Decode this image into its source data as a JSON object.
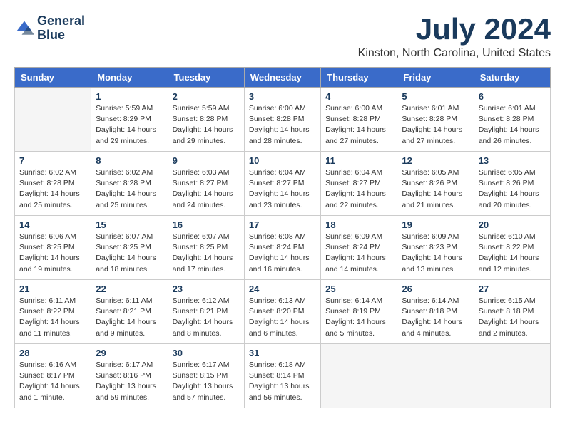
{
  "logo": {
    "line1": "General",
    "line2": "Blue"
  },
  "title": "July 2024",
  "location": "Kinston, North Carolina, United States",
  "days_of_week": [
    "Sunday",
    "Monday",
    "Tuesday",
    "Wednesday",
    "Thursday",
    "Friday",
    "Saturday"
  ],
  "weeks": [
    [
      {
        "day": "",
        "info": ""
      },
      {
        "day": "1",
        "info": "Sunrise: 5:59 AM\nSunset: 8:29 PM\nDaylight: 14 hours\nand 29 minutes."
      },
      {
        "day": "2",
        "info": "Sunrise: 5:59 AM\nSunset: 8:28 PM\nDaylight: 14 hours\nand 29 minutes."
      },
      {
        "day": "3",
        "info": "Sunrise: 6:00 AM\nSunset: 8:28 PM\nDaylight: 14 hours\nand 28 minutes."
      },
      {
        "day": "4",
        "info": "Sunrise: 6:00 AM\nSunset: 8:28 PM\nDaylight: 14 hours\nand 27 minutes."
      },
      {
        "day": "5",
        "info": "Sunrise: 6:01 AM\nSunset: 8:28 PM\nDaylight: 14 hours\nand 27 minutes."
      },
      {
        "day": "6",
        "info": "Sunrise: 6:01 AM\nSunset: 8:28 PM\nDaylight: 14 hours\nand 26 minutes."
      }
    ],
    [
      {
        "day": "7",
        "info": "Sunrise: 6:02 AM\nSunset: 8:28 PM\nDaylight: 14 hours\nand 25 minutes."
      },
      {
        "day": "8",
        "info": "Sunrise: 6:02 AM\nSunset: 8:28 PM\nDaylight: 14 hours\nand 25 minutes."
      },
      {
        "day": "9",
        "info": "Sunrise: 6:03 AM\nSunset: 8:27 PM\nDaylight: 14 hours\nand 24 minutes."
      },
      {
        "day": "10",
        "info": "Sunrise: 6:04 AM\nSunset: 8:27 PM\nDaylight: 14 hours\nand 23 minutes."
      },
      {
        "day": "11",
        "info": "Sunrise: 6:04 AM\nSunset: 8:27 PM\nDaylight: 14 hours\nand 22 minutes."
      },
      {
        "day": "12",
        "info": "Sunrise: 6:05 AM\nSunset: 8:26 PM\nDaylight: 14 hours\nand 21 minutes."
      },
      {
        "day": "13",
        "info": "Sunrise: 6:05 AM\nSunset: 8:26 PM\nDaylight: 14 hours\nand 20 minutes."
      }
    ],
    [
      {
        "day": "14",
        "info": "Sunrise: 6:06 AM\nSunset: 8:25 PM\nDaylight: 14 hours\nand 19 minutes."
      },
      {
        "day": "15",
        "info": "Sunrise: 6:07 AM\nSunset: 8:25 PM\nDaylight: 14 hours\nand 18 minutes."
      },
      {
        "day": "16",
        "info": "Sunrise: 6:07 AM\nSunset: 8:25 PM\nDaylight: 14 hours\nand 17 minutes."
      },
      {
        "day": "17",
        "info": "Sunrise: 6:08 AM\nSunset: 8:24 PM\nDaylight: 14 hours\nand 16 minutes."
      },
      {
        "day": "18",
        "info": "Sunrise: 6:09 AM\nSunset: 8:24 PM\nDaylight: 14 hours\nand 14 minutes."
      },
      {
        "day": "19",
        "info": "Sunrise: 6:09 AM\nSunset: 8:23 PM\nDaylight: 14 hours\nand 13 minutes."
      },
      {
        "day": "20",
        "info": "Sunrise: 6:10 AM\nSunset: 8:22 PM\nDaylight: 14 hours\nand 12 minutes."
      }
    ],
    [
      {
        "day": "21",
        "info": "Sunrise: 6:11 AM\nSunset: 8:22 PM\nDaylight: 14 hours\nand 11 minutes."
      },
      {
        "day": "22",
        "info": "Sunrise: 6:11 AM\nSunset: 8:21 PM\nDaylight: 14 hours\nand 9 minutes."
      },
      {
        "day": "23",
        "info": "Sunrise: 6:12 AM\nSunset: 8:21 PM\nDaylight: 14 hours\nand 8 minutes."
      },
      {
        "day": "24",
        "info": "Sunrise: 6:13 AM\nSunset: 8:20 PM\nDaylight: 14 hours\nand 6 minutes."
      },
      {
        "day": "25",
        "info": "Sunrise: 6:14 AM\nSunset: 8:19 PM\nDaylight: 14 hours\nand 5 minutes."
      },
      {
        "day": "26",
        "info": "Sunrise: 6:14 AM\nSunset: 8:18 PM\nDaylight: 14 hours\nand 4 minutes."
      },
      {
        "day": "27",
        "info": "Sunrise: 6:15 AM\nSunset: 8:18 PM\nDaylight: 14 hours\nand 2 minutes."
      }
    ],
    [
      {
        "day": "28",
        "info": "Sunrise: 6:16 AM\nSunset: 8:17 PM\nDaylight: 14 hours\nand 1 minute."
      },
      {
        "day": "29",
        "info": "Sunrise: 6:17 AM\nSunset: 8:16 PM\nDaylight: 13 hours\nand 59 minutes."
      },
      {
        "day": "30",
        "info": "Sunrise: 6:17 AM\nSunset: 8:15 PM\nDaylight: 13 hours\nand 57 minutes."
      },
      {
        "day": "31",
        "info": "Sunrise: 6:18 AM\nSunset: 8:14 PM\nDaylight: 13 hours\nand 56 minutes."
      },
      {
        "day": "",
        "info": ""
      },
      {
        "day": "",
        "info": ""
      },
      {
        "day": "",
        "info": ""
      }
    ]
  ]
}
